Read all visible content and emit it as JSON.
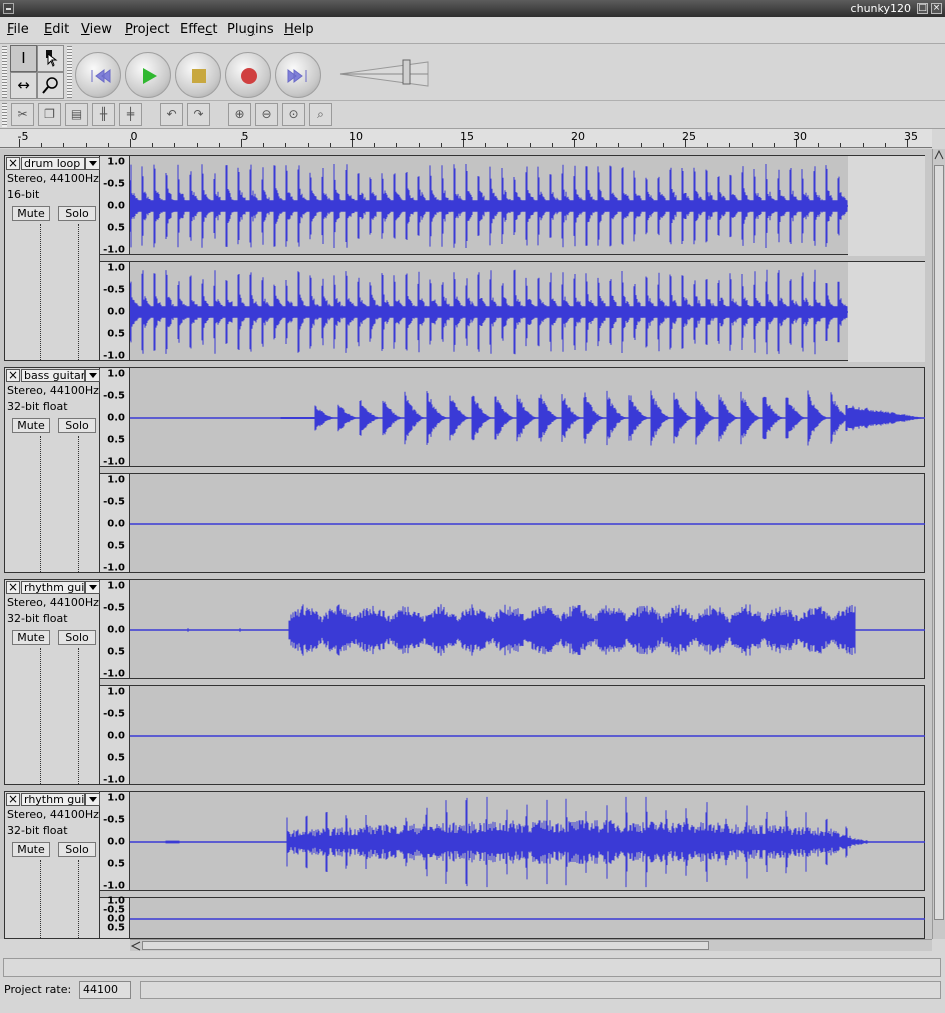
{
  "window": {
    "title": "chunky120"
  },
  "menu": [
    {
      "label": "File",
      "u": "F"
    },
    {
      "label": "Edit",
      "u": "E"
    },
    {
      "label": "View",
      "u": "V"
    },
    {
      "label": "Project",
      "u": "P"
    },
    {
      "label": "Effect",
      "u": "c"
    },
    {
      "label": "Plugins",
      "u": "g"
    },
    {
      "label": "Help",
      "u": "H"
    }
  ],
  "tools": {
    "selection": "selection-tool",
    "envelope": "envelope-tool",
    "timeshift": "time-shift-tool",
    "zoom": "zoom-tool"
  },
  "transport": {
    "rewind_icon": "skip-start-icon",
    "play_icon": "play-icon",
    "stop_icon": "stop-icon",
    "record_icon": "record-icon",
    "ffwd_icon": "skip-end-icon",
    "colors": {
      "rewind": "#8080d8",
      "play": "#30b830",
      "stop": "#c8a840",
      "record": "#d04040",
      "ffwd": "#8080d8"
    }
  },
  "ruler": {
    "ticks": [
      "-5",
      "0",
      "5",
      "10",
      "15",
      "20",
      "25",
      "30",
      "35"
    ]
  },
  "scale_labels": [
    "1.0",
    "-0.5",
    "0.0",
    "0.5",
    "-1.0"
  ],
  "tracks": [
    {
      "name": "drum loop",
      "info1": "Stereo, 44100Hz",
      "info2": "16-bit",
      "mute": "Mute",
      "solo": "Solo"
    },
    {
      "name": "bass guitar",
      "info1": "Stereo, 44100Hz",
      "info2": "32-bit float",
      "mute": "Mute",
      "solo": "Solo"
    },
    {
      "name": "rhythm guita",
      "info1": "Stereo, 44100Hz",
      "info2": "32-bit float",
      "mute": "Mute",
      "solo": "Solo"
    },
    {
      "name": "rhythm guita",
      "info1": "Stereo, 44100Hz",
      "info2": "32-bit float",
      "mute": "Mute",
      "solo": "Solo"
    }
  ],
  "footer": {
    "rate_label": "Project rate:",
    "rate_value": "44100"
  },
  "colors": {
    "waveform": "#3a3ad6",
    "track_bg": "#c3c3c3",
    "empty_bg": "#d9d9d9"
  }
}
